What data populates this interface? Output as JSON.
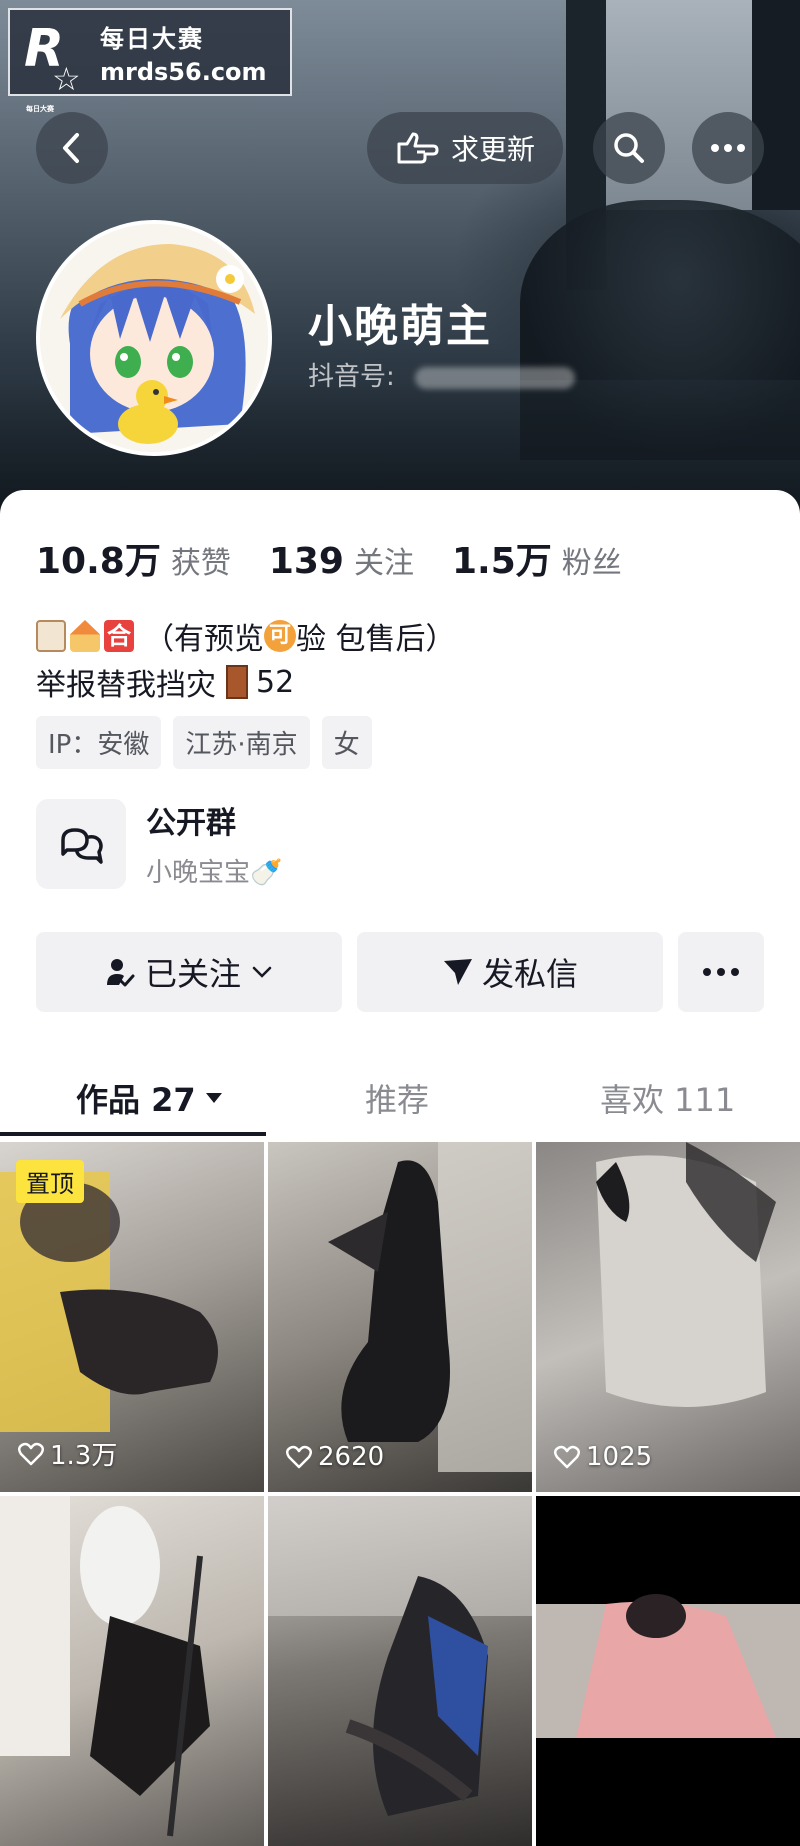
{
  "watermark": {
    "logo_letter": "R",
    "tiny_text": "每日大赛",
    "brand_cn": "每日大赛",
    "url": "mrds56.com"
  },
  "header": {
    "back_icon": "chevron-left-icon",
    "update_request_label": "求更新",
    "search_icon": "search-icon",
    "more_icon": "more-dots-icon"
  },
  "profile": {
    "name": "小晚萌主",
    "douyin_id_label": "抖音号:"
  },
  "stats": [
    {
      "value": "10.8万",
      "label": "获赞"
    },
    {
      "value": "139",
      "label": "关注"
    },
    {
      "value": "1.5万",
      "label": "粉丝"
    }
  ],
  "bio": {
    "line1_head": "（有预览",
    "line1_mid_emoji": "可",
    "line1_tail": "验 包售后）",
    "he_emoji": "合",
    "line2_text": "举报替我挡灾",
    "line2_count": "52"
  },
  "tags": [
    "IP：安徽",
    "江苏·南京",
    "女"
  ],
  "group": {
    "title": "公开群",
    "subtitle": "小晚宝宝🍼"
  },
  "actions": {
    "follow_label": "已关注",
    "message_label": "发私信"
  },
  "tabs": {
    "works": "作品 27",
    "recommend": "推荐",
    "likes": "喜欢 111"
  },
  "videos": [
    {
      "likes": "1.3万",
      "pinned": "置顶"
    },
    {
      "likes": "2620"
    },
    {
      "likes": "1025"
    },
    {
      "likes": ""
    },
    {
      "likes": ""
    },
    {
      "likes": ""
    }
  ],
  "colors": {
    "pin_badge": "#fce33d",
    "text_primary": "#161823",
    "text_secondary": "#8a8b91"
  }
}
